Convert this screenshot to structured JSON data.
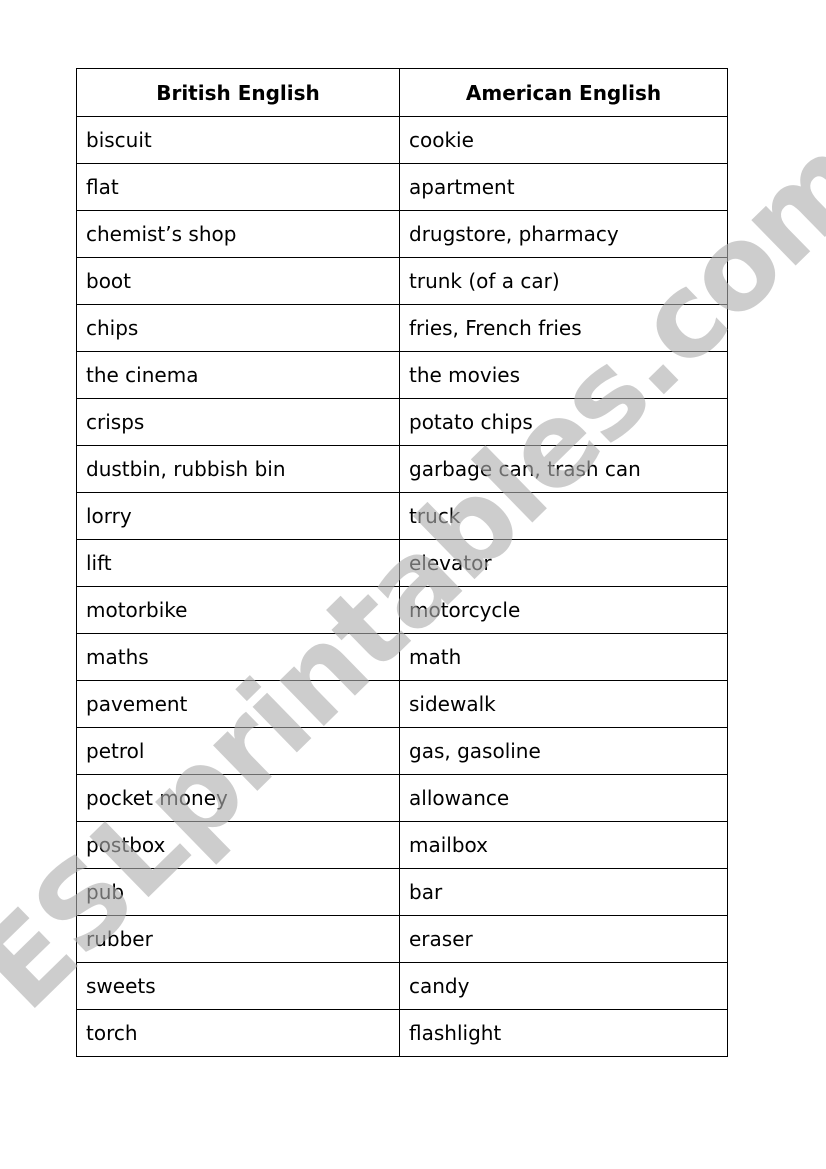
{
  "table": {
    "headers": [
      "British English",
      "American English"
    ],
    "rows": [
      [
        "biscuit",
        "cookie"
      ],
      [
        "flat",
        "apartment"
      ],
      [
        "chemist’s shop",
        "drugstore, pharmacy"
      ],
      [
        "boot",
        "trunk (of a car)"
      ],
      [
        "chips",
        "fries, French fries"
      ],
      [
        "the cinema",
        "the movies"
      ],
      [
        "crisps",
        "potato chips"
      ],
      [
        "dustbin, rubbish bin",
        "garbage can, trash can"
      ],
      [
        "lorry",
        "truck"
      ],
      [
        "lift",
        "elevator"
      ],
      [
        "motorbike",
        "motorcycle"
      ],
      [
        "maths",
        "math"
      ],
      [
        "pavement",
        "sidewalk"
      ],
      [
        "petrol",
        "gas, gasoline"
      ],
      [
        "pocket money",
        "allowance"
      ],
      [
        "postbox",
        "mailbox"
      ],
      [
        "pub",
        "bar"
      ],
      [
        "rubber",
        "eraser"
      ],
      [
        "sweets",
        "candy"
      ],
      [
        "torch",
        "flashlight"
      ]
    ]
  },
  "watermark": {
    "text": "ESLprintables.com",
    "color": "#c8c8c8"
  }
}
